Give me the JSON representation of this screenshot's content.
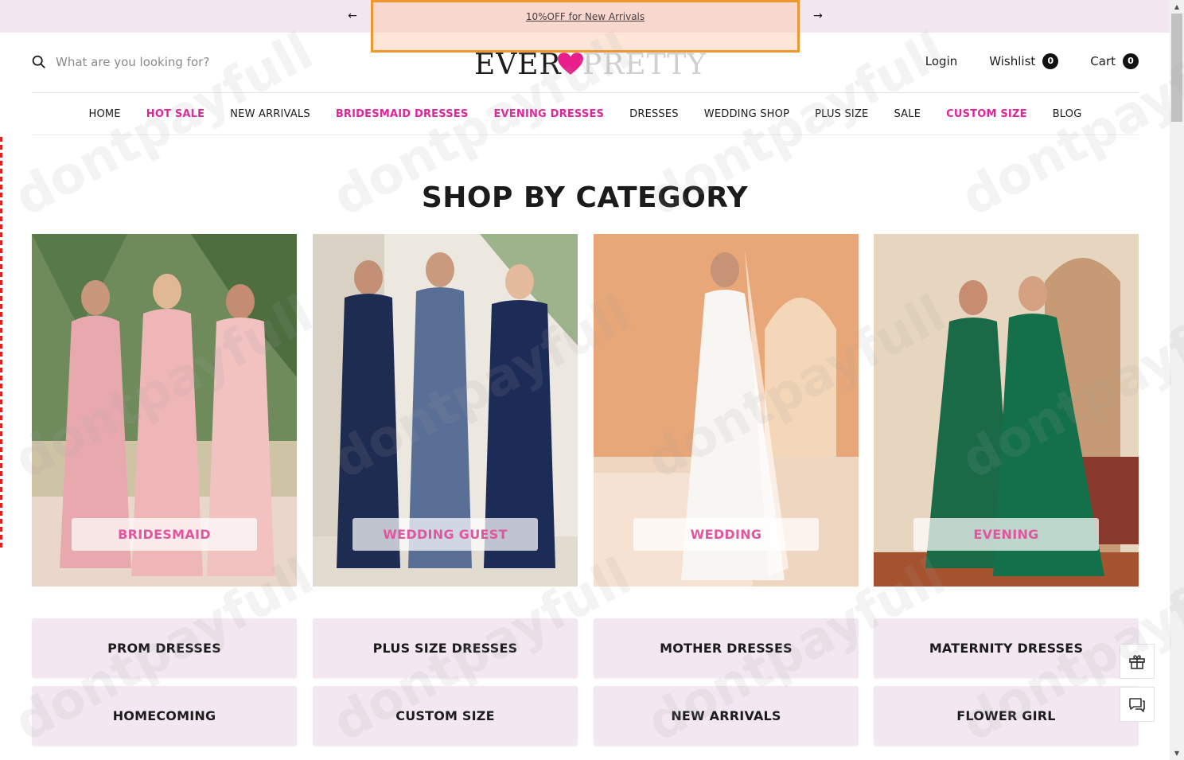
{
  "announcement": {
    "text": "10%OFF for New Arrivals",
    "prev_icon": "arrow-left-icon",
    "next_icon": "arrow-right-icon"
  },
  "header": {
    "search_placeholder": "What are you looking for?",
    "logo_left": "EVER",
    "logo_right": "PRETTY",
    "login_label": "Login",
    "wishlist_label": "Wishlist",
    "wishlist_count": "0",
    "cart_label": "Cart",
    "cart_count": "0"
  },
  "nav": {
    "items": [
      {
        "label": "HOME",
        "highlight": false
      },
      {
        "label": "HOT SALE",
        "highlight": true
      },
      {
        "label": "NEW ARRIVALS",
        "highlight": false
      },
      {
        "label": "BRIDESMAID DRESSES",
        "highlight": true
      },
      {
        "label": "EVENING DRESSES",
        "highlight": true
      },
      {
        "label": "DRESSES",
        "highlight": false
      },
      {
        "label": "WEDDING SHOP",
        "highlight": false
      },
      {
        "label": "PLUS SIZE",
        "highlight": false
      },
      {
        "label": "SALE",
        "highlight": false
      },
      {
        "label": "CUSTOM SIZE",
        "highlight": true
      },
      {
        "label": "BLOG",
        "highlight": false
      }
    ]
  },
  "section": {
    "title": "SHOP BY CATEGORY"
  },
  "categories": [
    {
      "label": "BRIDESMAID"
    },
    {
      "label": "WEDDING GUEST"
    },
    {
      "label": "WEDDING"
    },
    {
      "label": "EVENING"
    }
  ],
  "tiles": [
    {
      "label": "PROM DRESSES"
    },
    {
      "label": "PLUS SIZE DRESSES"
    },
    {
      "label": "MOTHER DRESSES"
    },
    {
      "label": "MATERNITY DRESSES"
    },
    {
      "label": "HOMECOMING"
    },
    {
      "label": "CUSTOM SIZE"
    },
    {
      "label": "NEW ARRIVALS"
    },
    {
      "label": "FLOWER GIRL"
    }
  ],
  "colors": {
    "accent_pink": "#e1239b",
    "label_pink": "#e0579f",
    "tile_bg": "#f3e8f1",
    "promo_outline": "#f0962f"
  },
  "watermark": "dontpayfull"
}
